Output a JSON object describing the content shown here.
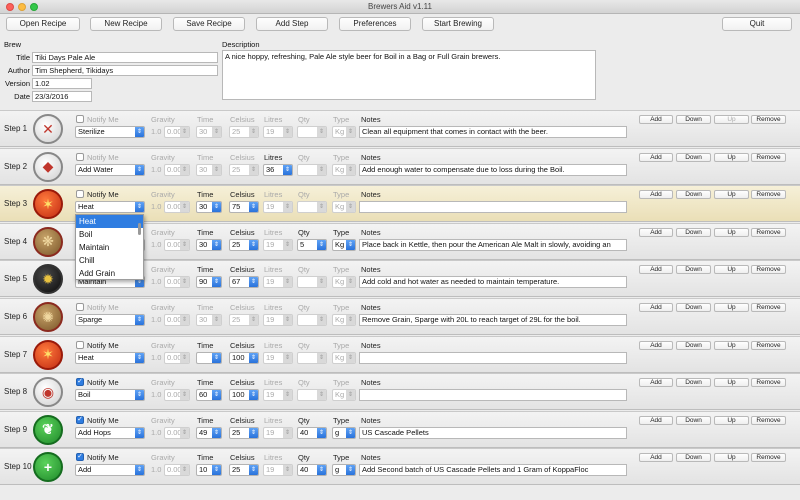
{
  "window": {
    "title": "Brewers Aid v1.11"
  },
  "toolbar": [
    "Open Recipe",
    "New Recipe",
    "Save Recipe",
    "Add Step",
    "Preferences",
    "Start Brewing",
    "Quit"
  ],
  "brew": {
    "heading": "Brew",
    "title_label": "Title",
    "title": "Tiki Days Pale Ale",
    "author_label": "Author",
    "author": "Tim Shepherd, Tikidays",
    "version_label": "Version",
    "version": "1.02",
    "date_label": "Date",
    "date": "23/3/2016",
    "description_label": "Description",
    "description": "A nice hoppy, refreshing, Pale Ale style beer for Boil in a Bag or Full Grain brewers."
  },
  "columns": {
    "notify": "Notify Me",
    "gravity": "Gravity",
    "time": "Time",
    "celsius": "Celsius",
    "litres": "Litres",
    "qty": "Qty",
    "type": "Type",
    "notes": "Notes"
  },
  "row_buttons": {
    "add": "Add",
    "down": "Down",
    "up": "Up",
    "remove": "Remove"
  },
  "steps": [
    {
      "name": "Step 1",
      "icon": "sterilize-icon",
      "notify": false,
      "action": "Sterilize",
      "gravity": "1.0",
      "gravity2": "0.00",
      "time": "30",
      "celsius": "25",
      "litres": "19",
      "qty": "",
      "type": "Kg",
      "notes": "Clean all equipment that comes in contact with the beer."
    },
    {
      "name": "Step 2",
      "icon": "water-icon",
      "notify": false,
      "action": "Add Water",
      "gravity": "1.0",
      "gravity2": "0.00",
      "time": "30",
      "celsius": "25",
      "litres": "36",
      "qty": "",
      "type": "Kg",
      "notes": "Add enough water to compensate due to loss during the Boil."
    },
    {
      "name": "Step 3",
      "icon": "heat-icon",
      "notify": false,
      "action": "Heat",
      "gravity": "1.0",
      "gravity2": "0.00",
      "time": "30",
      "celsius": "75",
      "litres": "19",
      "qty": "",
      "type": "Kg",
      "notes": ""
    },
    {
      "name": "Step 4",
      "icon": "grain-icon",
      "notify": false,
      "action": "",
      "gravity": "1.0",
      "gravity2": "0.00",
      "time": "30",
      "celsius": "25",
      "litres": "19",
      "qty": "5",
      "type": "Kg",
      "notes": "Place back in Kettle, then pour the American Ale Malt in slowly, avoiding an"
    },
    {
      "name": "Step 5",
      "icon": "maintain-icon",
      "notify": false,
      "action": "Maintain",
      "gravity": "1.0",
      "gravity2": "0.00",
      "time": "90",
      "celsius": "67",
      "litres": "19",
      "qty": "",
      "type": "Kg",
      "notes": "Add cold and hot water as needed to maintain temperature."
    },
    {
      "name": "Step 6",
      "icon": "sparge-icon",
      "notify": false,
      "action": "Sparge",
      "gravity": "1.0",
      "gravity2": "0.00",
      "time": "30",
      "celsius": "25",
      "litres": "19",
      "qty": "",
      "type": "Kg",
      "notes": "Remove Grain, Sparge with 20L to reach target of 29L for the boil."
    },
    {
      "name": "Step 7",
      "icon": "heat-icon",
      "notify": false,
      "action": "Heat",
      "gravity": "1.0",
      "gravity2": "0.00",
      "time": "",
      "celsius": "100",
      "litres": "19",
      "qty": "",
      "type": "Kg",
      "notes": ""
    },
    {
      "name": "Step 8",
      "icon": "boil-icon",
      "notify": true,
      "action": "Boil",
      "gravity": "1.0",
      "gravity2": "0.00",
      "time": "60",
      "celsius": "100",
      "litres": "19",
      "qty": "",
      "type": "Kg",
      "notes": ""
    },
    {
      "name": "Step 9",
      "icon": "hops-icon",
      "notify": true,
      "action": "Add Hops",
      "gravity": "1.0",
      "gravity2": "0.00",
      "time": "49",
      "celsius": "25",
      "litres": "19",
      "qty": "40",
      "type": "g",
      "notes": "US Cascade Pellets"
    },
    {
      "name": "Step 10",
      "icon": "add-icon",
      "notify": true,
      "action": "Add",
      "gravity": "1.0",
      "gravity2": "0.00",
      "time": "10",
      "celsius": "25",
      "litres": "19",
      "qty": "40",
      "type": "g",
      "notes": "Add Second batch of US Cascade Pellets and 1 Gram of KoppaFloc"
    }
  ],
  "dropdown": {
    "options": [
      "Heat",
      "Boil",
      "Maintain",
      "Chill",
      "Add Grain"
    ],
    "selected": "Heat"
  },
  "colors": {
    "accent": "#2f7de1",
    "highlight_row": "#f2e9c6"
  }
}
